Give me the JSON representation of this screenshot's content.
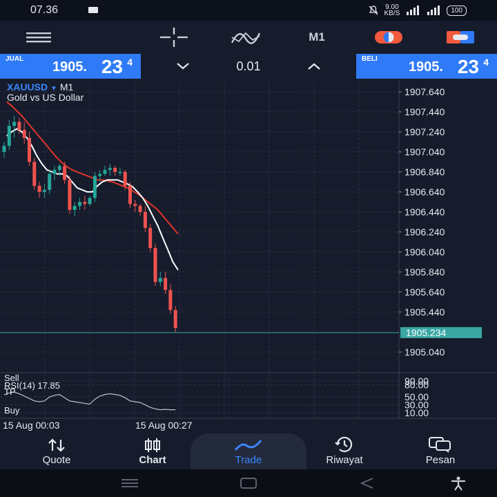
{
  "status": {
    "time": "07.36",
    "net_speed": "9.00",
    "net_unit": "KB/S",
    "battery": "100"
  },
  "toolbar": {
    "timeframe": "M1"
  },
  "trade": {
    "sell_label": "JUAL",
    "buy_label": "BELI",
    "sell_price_main": "1905.",
    "sell_price_big": "23",
    "sell_price_sup": "4",
    "buy_price_main": "1905.",
    "buy_price_big": "23",
    "buy_price_sup": "4",
    "volume": "0.01"
  },
  "chart": {
    "symbol": "XAUUSD",
    "timeframe": "M1",
    "description": "Gold vs US Dollar",
    "current_price": "1905.234",
    "sell_overlay": "Sell",
    "tp_overlay": "TP",
    "buy_overlay": "Buy",
    "rsi_label": "RSI(14) 17.85",
    "time_labels": [
      "15 Aug 00:03",
      "15 Aug 00:27"
    ]
  },
  "chart_data": {
    "type": "candlestick",
    "price_ticks": [
      1907.64,
      1907.44,
      1907.24,
      1907.04,
      1906.84,
      1906.64,
      1906.44,
      1906.24,
      1906.04,
      1905.84,
      1905.64,
      1905.44,
      1905.04
    ],
    "rsi_ticks": [
      "90.00",
      "80.00",
      "50.00",
      "30.00",
      "10.00"
    ],
    "bid": 1905.234,
    "candles": [
      {
        "o": 1907.04,
        "h": 1907.14,
        "l": 1906.98,
        "c": 1907.1
      },
      {
        "o": 1907.1,
        "h": 1907.36,
        "l": 1907.06,
        "c": 1907.3
      },
      {
        "o": 1907.3,
        "h": 1907.4,
        "l": 1907.18,
        "c": 1907.34
      },
      {
        "o": 1907.34,
        "h": 1907.38,
        "l": 1907.22,
        "c": 1907.26
      },
      {
        "o": 1907.26,
        "h": 1907.34,
        "l": 1907.12,
        "c": 1907.18
      },
      {
        "o": 1907.18,
        "h": 1907.24,
        "l": 1906.9,
        "c": 1906.94
      },
      {
        "o": 1906.94,
        "h": 1906.98,
        "l": 1906.66,
        "c": 1906.7
      },
      {
        "o": 1906.7,
        "h": 1906.74,
        "l": 1906.58,
        "c": 1906.64
      },
      {
        "o": 1906.64,
        "h": 1906.72,
        "l": 1906.58,
        "c": 1906.66
      },
      {
        "o": 1906.66,
        "h": 1906.86,
        "l": 1906.62,
        "c": 1906.82
      },
      {
        "o": 1906.82,
        "h": 1906.9,
        "l": 1906.76,
        "c": 1906.86
      },
      {
        "o": 1906.86,
        "h": 1906.92,
        "l": 1906.8,
        "c": 1906.9
      },
      {
        "o": 1906.9,
        "h": 1906.94,
        "l": 1906.72,
        "c": 1906.76
      },
      {
        "o": 1906.76,
        "h": 1906.8,
        "l": 1906.42,
        "c": 1906.46
      },
      {
        "o": 1906.46,
        "h": 1906.54,
        "l": 1906.4,
        "c": 1906.5
      },
      {
        "o": 1906.5,
        "h": 1906.58,
        "l": 1906.46,
        "c": 1906.54
      },
      {
        "o": 1906.54,
        "h": 1906.6,
        "l": 1906.46,
        "c": 1906.52
      },
      {
        "o": 1906.52,
        "h": 1906.6,
        "l": 1906.5,
        "c": 1906.58
      },
      {
        "o": 1906.58,
        "h": 1906.84,
        "l": 1906.54,
        "c": 1906.8
      },
      {
        "o": 1906.8,
        "h": 1906.86,
        "l": 1906.74,
        "c": 1906.82
      },
      {
        "o": 1906.82,
        "h": 1906.9,
        "l": 1906.8,
        "c": 1906.86
      },
      {
        "o": 1906.86,
        "h": 1906.92,
        "l": 1906.8,
        "c": 1906.88
      },
      {
        "o": 1906.88,
        "h": 1906.9,
        "l": 1906.8,
        "c": 1906.84
      },
      {
        "o": 1906.84,
        "h": 1906.88,
        "l": 1906.8,
        "c": 1906.84
      },
      {
        "o": 1906.84,
        "h": 1906.86,
        "l": 1906.66,
        "c": 1906.7
      },
      {
        "o": 1906.7,
        "h": 1906.74,
        "l": 1906.48,
        "c": 1906.52
      },
      {
        "o": 1906.52,
        "h": 1906.56,
        "l": 1906.44,
        "c": 1906.5
      },
      {
        "o": 1906.5,
        "h": 1906.52,
        "l": 1906.4,
        "c": 1906.44
      },
      {
        "o": 1906.44,
        "h": 1906.5,
        "l": 1906.24,
        "c": 1906.28
      },
      {
        "o": 1906.28,
        "h": 1906.32,
        "l": 1906.04,
        "c": 1906.08
      },
      {
        "o": 1906.08,
        "h": 1906.12,
        "l": 1905.7,
        "c": 1905.74
      },
      {
        "o": 1905.74,
        "h": 1905.84,
        "l": 1905.7,
        "c": 1905.78
      },
      {
        "o": 1905.78,
        "h": 1905.84,
        "l": 1905.62,
        "c": 1905.66
      },
      {
        "o": 1905.66,
        "h": 1905.72,
        "l": 1905.42,
        "c": 1905.46
      },
      {
        "o": 1905.46,
        "h": 1905.5,
        "l": 1905.24,
        "c": 1905.28
      }
    ],
    "ma_red": [
      1907.54,
      1907.5,
      1907.45,
      1907.4,
      1907.34,
      1907.28,
      1907.22,
      1907.16,
      1907.1,
      1907.04,
      1906.98,
      1906.93,
      1906.89,
      1906.86,
      1906.84,
      1906.82,
      1906.8,
      1906.78,
      1906.76,
      1906.76,
      1906.75,
      1906.74,
      1906.72,
      1906.7,
      1906.68,
      1906.65,
      1906.62,
      1906.58,
      1906.54,
      1906.5,
      1906.46,
      1906.4,
      1906.34,
      1906.28,
      1906.22
    ],
    "ma_white": [
      1907.2,
      1907.24,
      1907.27,
      1907.24,
      1907.18,
      1907.1,
      1907.0,
      1906.92,
      1906.86,
      1906.84,
      1906.82,
      1906.82,
      1906.8,
      1906.74,
      1906.68,
      1906.66,
      1906.64,
      1906.64,
      1906.7,
      1906.74,
      1906.76,
      1906.76,
      1906.76,
      1906.74,
      1906.72,
      1906.69,
      1906.64,
      1906.58,
      1906.5,
      1906.4,
      1906.3,
      1906.18,
      1906.06,
      1905.94,
      1905.86
    ],
    "rsi_values": [
      55,
      60,
      62,
      58,
      52,
      46,
      40,
      38,
      40,
      50,
      54,
      56,
      48,
      40,
      38,
      36,
      34,
      32,
      44,
      52,
      56,
      58,
      56,
      54,
      48,
      40,
      38,
      36,
      30,
      24,
      20,
      18,
      19,
      18,
      17.85
    ]
  },
  "bottom_nav": {
    "items": [
      {
        "label": "Quote"
      },
      {
        "label": "Chart"
      },
      {
        "label": "Trade"
      },
      {
        "label": "Riwayat"
      },
      {
        "label": "Pesan"
      }
    ]
  }
}
